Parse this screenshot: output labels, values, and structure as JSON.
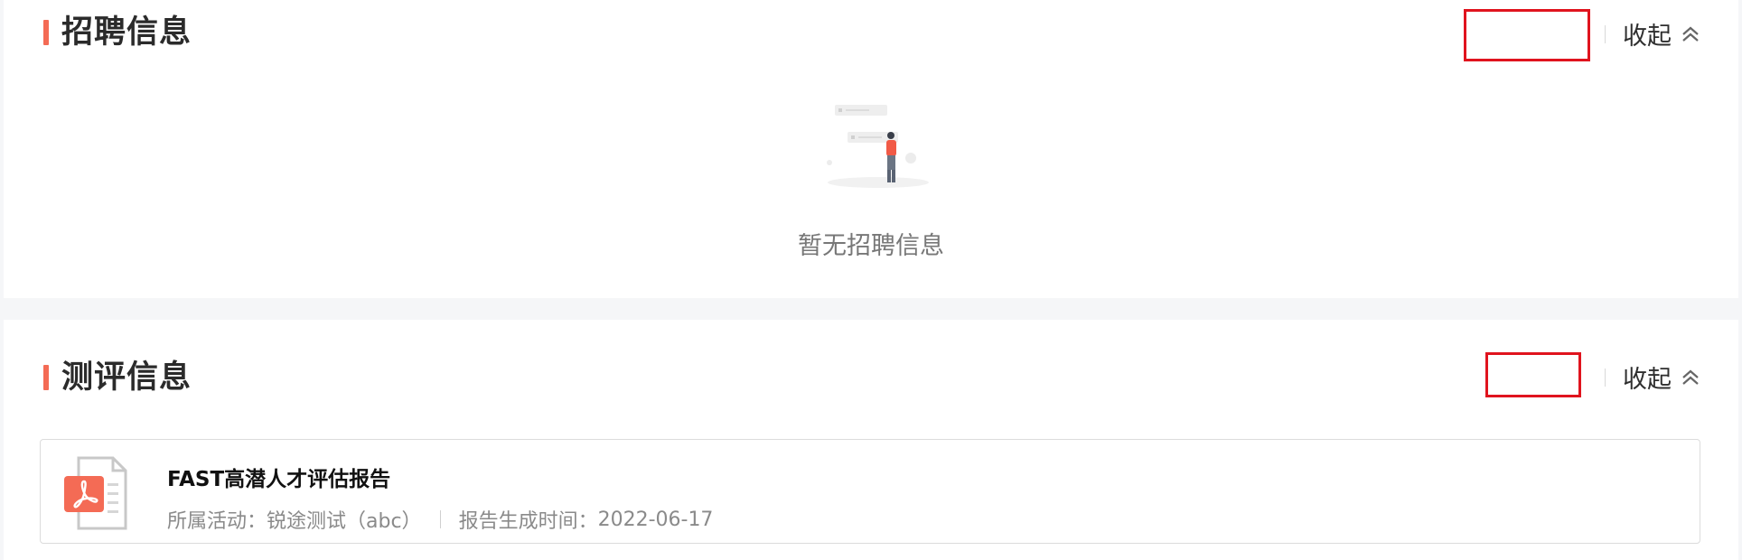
{
  "recruitment": {
    "title": "招聘信息",
    "collapse_label": "收起",
    "empty_text": "暂无招聘信息"
  },
  "assessment": {
    "title": "测评信息",
    "collapse_label": "收起",
    "report": {
      "title": "FAST高潜人才评估报告",
      "activity_label": "所属活动：",
      "activity_value": "锐途测试（abc）",
      "time_label": "报告生成时间：",
      "time_value": "2022-06-17"
    }
  },
  "colors": {
    "accent": "#f46b55",
    "highlight_box": "#e0141e"
  },
  "icons": {
    "collapse": "chevrons-up-icon",
    "report": "pdf-file-icon",
    "empty": "empty-state-illustration"
  }
}
